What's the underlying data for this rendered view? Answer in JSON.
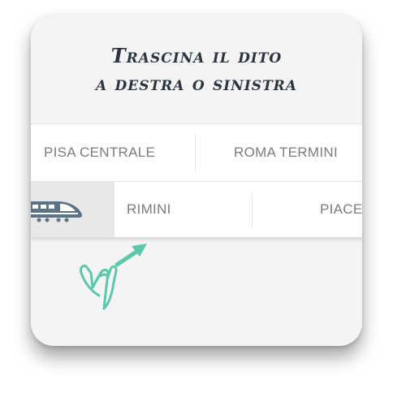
{
  "header": {
    "title_line1": "Trascina il dito",
    "title_line2": "a destra o sinistra"
  },
  "stations_row1": [
    "PISA CENTRALE",
    "ROMA TERMINI"
  ],
  "stations_row2": [
    "RIMINI",
    "PIACE"
  ],
  "icons": {
    "train": "train-icon",
    "hand": "hand-pointer-icon",
    "arrow": "swipe-arrow-icon"
  },
  "colors": {
    "accent": "#5cc7ad",
    "title": "#2a3540",
    "train": "#5d7383"
  }
}
